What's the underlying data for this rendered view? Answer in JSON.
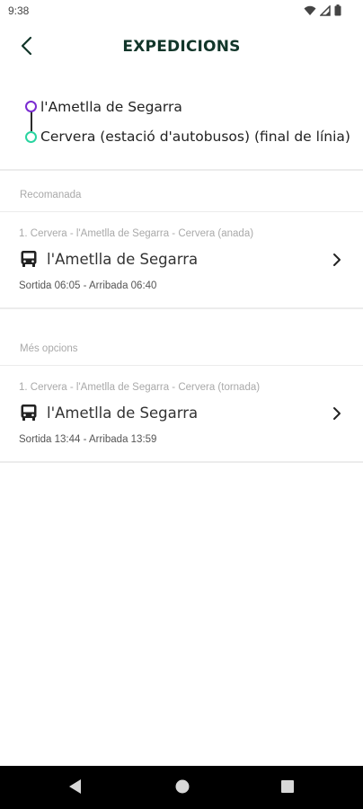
{
  "status_bar": {
    "time": "9:38",
    "icons": [
      "wifi-icon",
      "signal-icon",
      "battery-icon"
    ]
  },
  "header": {
    "title": "EXPEDICIONS",
    "back_icon": "arrow-back-icon"
  },
  "route": {
    "origin": "l'Ametlla de Segarra",
    "destination": "Cervera (estació d'autobusos) (final de línia)",
    "origin_color": "#7a2bd1",
    "destination_color": "#2ad4a0"
  },
  "sections": {
    "recommended": {
      "label": "Recomanada",
      "trips": [
        {
          "route": "1. Cervera - l'Ametlla de Segarra - Cervera (anada)",
          "destination": "l'Ametlla de Segarra",
          "times": "Sortida 06:05 - Arribada 06:40"
        }
      ]
    },
    "more": {
      "label": "Més opcions",
      "trips": [
        {
          "route": "1. Cervera - l'Ametlla de Segarra - Cervera (tornada)",
          "destination": "l'Ametlla de Segarra",
          "times": "Sortida 13:44 - Arribada 13:59"
        }
      ]
    }
  },
  "nav_bar": {
    "buttons": [
      "back-triangle-icon",
      "home-circle-icon",
      "recents-square-icon"
    ]
  }
}
